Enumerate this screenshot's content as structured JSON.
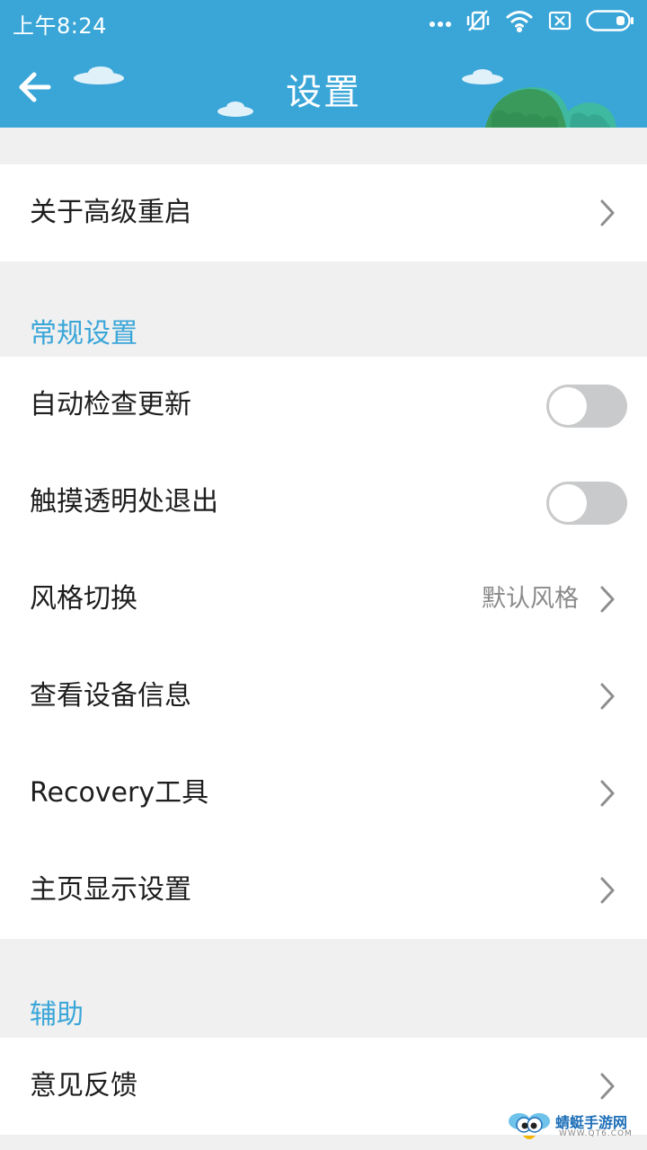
{
  "status_bar": {
    "time": "上午8:24",
    "icons": [
      "more-dots-icon",
      "vibrate-off-icon",
      "wifi-icon",
      "sim-off-icon",
      "battery-icon"
    ]
  },
  "header": {
    "title": "设置",
    "back_icon": "back-arrow-icon",
    "background_color": "#3aa6d8"
  },
  "top_group": {
    "items": [
      {
        "label": "关于高级重启",
        "type": "link"
      }
    ]
  },
  "general": {
    "title": "常规设置",
    "items": [
      {
        "label": "自动检查更新",
        "type": "toggle",
        "on": false
      },
      {
        "label": "触摸透明处退出",
        "type": "toggle",
        "on": false
      },
      {
        "label": "风格切换",
        "type": "link",
        "value": "默认风格"
      },
      {
        "label": "查看设备信息",
        "type": "link"
      },
      {
        "label": "Recovery工具",
        "type": "link"
      },
      {
        "label": "主页显示设置",
        "type": "link"
      }
    ]
  },
  "assist": {
    "title": "辅助",
    "items": [
      {
        "label": "意见反馈",
        "type": "link"
      }
    ]
  },
  "watermark": {
    "text": "蜻蜓手游网",
    "sub": "WWW.QT6.COM"
  },
  "colors": {
    "accent": "#3aa6d8",
    "page_bg": "#f0f0f0",
    "toggle_off": "#c9cacb",
    "hill_dark": "#3a9a5c",
    "hill_light": "#3fb9a0"
  }
}
